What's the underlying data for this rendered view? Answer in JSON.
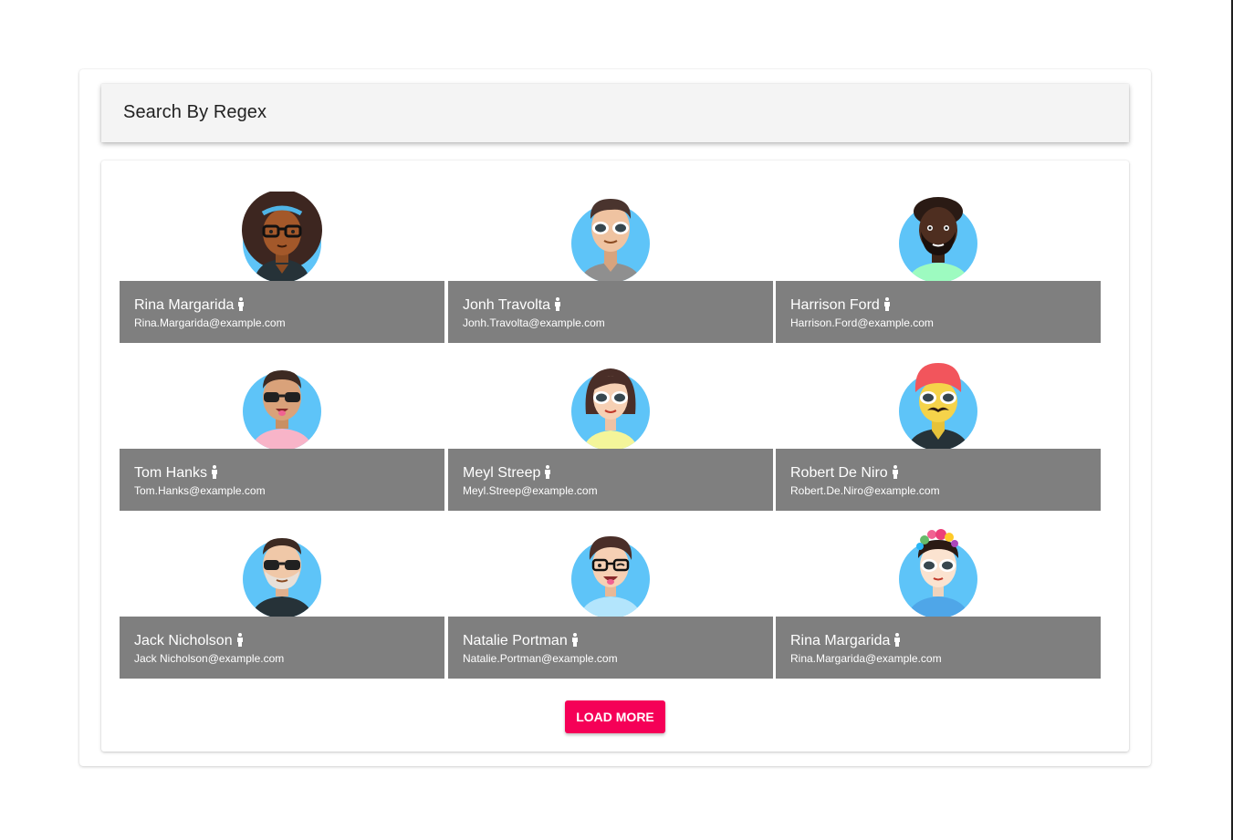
{
  "header": {
    "title": "Search By Regex"
  },
  "users": [
    {
      "name": "Rina Margarida",
      "email": "Rina.Margarida@example.com",
      "gender_icon": "person-icon"
    },
    {
      "name": "Jonh Travolta",
      "email": "Jonh.Travolta@example.com",
      "gender_icon": "person-icon"
    },
    {
      "name": "Harrison Ford",
      "email": "Harrison.Ford@example.com",
      "gender_icon": "person-icon"
    },
    {
      "name": "Tom Hanks",
      "email": "Tom.Hanks@example.com",
      "gender_icon": "person-icon"
    },
    {
      "name": "Meyl Streep",
      "email": "Meyl.Streep@example.com",
      "gender_icon": "person-icon"
    },
    {
      "name": "Robert De Niro",
      "email": "Robert.De.Niro@example.com",
      "gender_icon": "person-icon"
    },
    {
      "name": "Jack Nicholson",
      "email": "Jack Nicholson@example.com",
      "gender_icon": "person-icon"
    },
    {
      "name": "Natalie Portman",
      "email": "Natalie.Portman@example.com",
      "gender_icon": "person-icon"
    },
    {
      "name": "Rina Margarida",
      "email": "Rina.Margarida@example.com",
      "gender_icon": "person-icon"
    }
  ],
  "load_more_label": "LOAD MORE",
  "colors": {
    "header_bg": "#f4f4f4",
    "tile_bar": "#7f7f7f",
    "avatar_bg": "#5ec4f8",
    "accent": "#f50057"
  }
}
